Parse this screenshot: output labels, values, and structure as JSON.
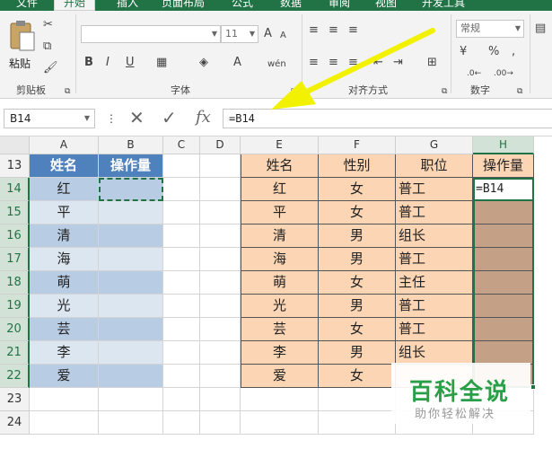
{
  "ribbon_tabs": [
    "文件",
    "开始",
    "插入",
    "页面布局",
    "公式",
    "数据",
    "审阅",
    "视图",
    "开发工具"
  ],
  "clipboard": {
    "paste": "粘贴",
    "group": "剪贴板"
  },
  "font_group": {
    "font_name": "",
    "font_size": "11",
    "label": "字体"
  },
  "align_group": {
    "label": "对齐方式"
  },
  "number_group": {
    "format": "常规",
    "label": "数字"
  },
  "formula_bar": {
    "name_box": "B14",
    "fx": "fx",
    "formula": "=B14"
  },
  "columns": [
    "A",
    "B",
    "C",
    "D",
    "E",
    "F",
    "G",
    "H"
  ],
  "rows": [
    "13",
    "14",
    "15",
    "16",
    "17",
    "18",
    "19",
    "20",
    "21",
    "22",
    "23",
    "24"
  ],
  "left_table": {
    "headers": [
      "姓名",
      "操作量"
    ],
    "names": [
      "红",
      "平",
      "清",
      "海",
      "萌",
      "光",
      "芸",
      "李",
      "爱"
    ]
  },
  "right_table": {
    "headers": [
      "姓名",
      "性别",
      "职位",
      "操作量"
    ],
    "rows": [
      [
        "红",
        "女",
        "普工",
        "=B14"
      ],
      [
        "平",
        "女",
        "普工",
        ""
      ],
      [
        "清",
        "男",
        "组长",
        ""
      ],
      [
        "海",
        "男",
        "普工",
        ""
      ],
      [
        "萌",
        "女",
        "主任",
        ""
      ],
      [
        "光",
        "男",
        "普工",
        ""
      ],
      [
        "芸",
        "女",
        "普工",
        ""
      ],
      [
        "李",
        "男",
        "组长",
        ""
      ],
      [
        "爱",
        "女",
        "",
        ""
      ]
    ]
  },
  "watermark": {
    "title": "百科全说",
    "subtitle": "助你轻松解决"
  },
  "colors": {
    "excel_green": "#217346",
    "left_header": "#4f81bd",
    "left_dark": "#b8cce4",
    "left_light": "#dce6f1",
    "right_fill": "#fcd5b4",
    "h_fill": "#c4a086",
    "arrow": "#f2f200"
  }
}
